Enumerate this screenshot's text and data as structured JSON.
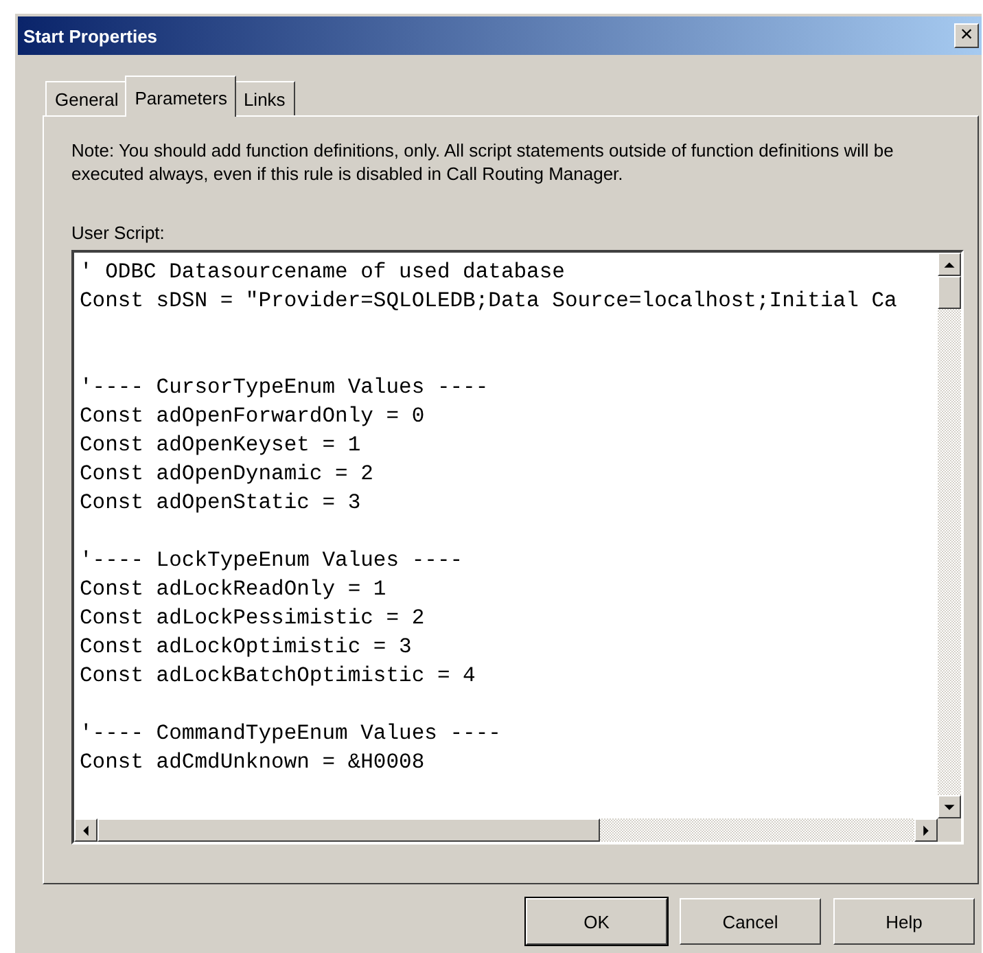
{
  "window": {
    "title": "Start Properties",
    "close_glyph": "×"
  },
  "tabs": [
    {
      "label": "General",
      "selected": false
    },
    {
      "label": "Parameters",
      "selected": true
    },
    {
      "label": "Links",
      "selected": false
    }
  ],
  "note": "Note: You should add function definitions, only. All script statements outside of function definitions will be executed always, even if this rule is disabled in Call Routing Manager.",
  "user_script": {
    "label": "User Script:",
    "text": "' ODBC Datasourcename of used database\nConst sDSN = \"Provider=SQLOLEDB;Data Source=localhost;Initial Ca\n\n\n'---- CursorTypeEnum Values ----\nConst adOpenForwardOnly = 0\nConst adOpenKeyset = 1\nConst adOpenDynamic = 2\nConst adOpenStatic = 3\n\n'---- LockTypeEnum Values ----\nConst adLockReadOnly = 1\nConst adLockPessimistic = 2\nConst adLockOptimistic = 3\nConst adLockBatchOptimistic = 4\n\n'---- CommandTypeEnum Values ----\nConst adCmdUnknown = &H0008"
  },
  "buttons": [
    {
      "label": "OK",
      "default": true
    },
    {
      "label": "Cancel",
      "default": false
    },
    {
      "label": "Help",
      "default": false
    }
  ]
}
